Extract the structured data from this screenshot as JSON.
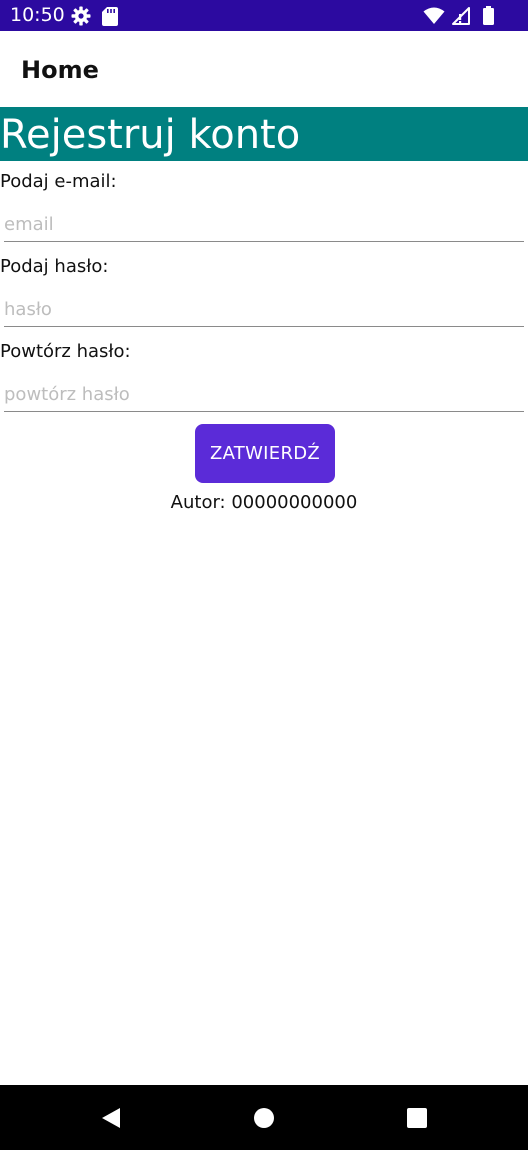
{
  "status_bar": {
    "time": "10:50",
    "left_icons": [
      "gear-icon",
      "sd-card-icon"
    ],
    "right_icons": [
      "wifi-icon",
      "signal-icon",
      "battery-icon"
    ],
    "background": "#2c0aa0"
  },
  "app_bar": {
    "title": "Home"
  },
  "heading": {
    "text": "Rejestruj konto",
    "background": "#008080"
  },
  "form": {
    "email": {
      "label": "Podaj e-mail:",
      "placeholder": "email",
      "value": ""
    },
    "password": {
      "label": "Podaj hasło:",
      "placeholder": "hasło",
      "value": ""
    },
    "repeat_password": {
      "label": "Powtórz hasło:",
      "placeholder": "powtórz hasło",
      "value": ""
    },
    "submit_label": "ZATWIERDŹ",
    "submit_color": "#5b2bd8"
  },
  "author": "Autor: 00000000000",
  "nav_bar": {
    "buttons": [
      "back-icon",
      "home-icon",
      "recents-icon"
    ]
  }
}
